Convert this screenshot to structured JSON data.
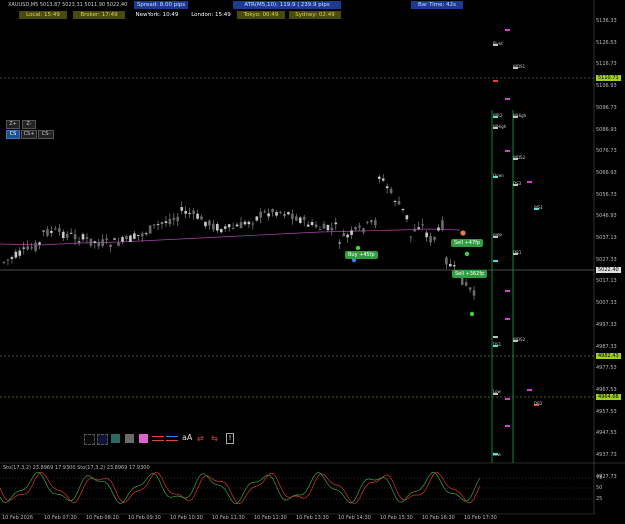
{
  "header": {
    "symbol_ohlc": "XAUUSD,M5  5013.87 5023.31 5011.90 5022.40",
    "spread": "Spread: 8.00 pips",
    "atr": "ATR(M5,10): 119.9  |  239.9 pips",
    "bar_time": "Bar Time: 42s",
    "sessions": {
      "local": "Local: 15:49",
      "broker": "Broker: 17:49",
      "newyork": "NewYork: 10:49",
      "london": "London: 15:49",
      "tokyo": "Tokyo: 00:49",
      "sydney": "Sydney: 02:49"
    }
  },
  "controls": {
    "zoom_in": "Z+",
    "zoom": "Z-",
    "cs_active": "CS",
    "cs_plus": "CS+",
    "cs_minus": "CS-"
  },
  "toolbar": {
    "font_label": "aA",
    "info_label": "!"
  },
  "price_axis": [
    "5136.33",
    "5126.53",
    "5116.73",
    "5106.93",
    "5096.73",
    "5086.93",
    "5076.73",
    "5066.93",
    "5056.73",
    "5046.93",
    "5037.13",
    "5027.33",
    "5017.13",
    "5007.33",
    "4997.33",
    "4987.33",
    "4977.53",
    "4967.53",
    "4957.53",
    "4947.53",
    "4937.73",
    "4927.73"
  ],
  "highlight_prices": {
    "upper": "5110.71",
    "current": "5022.40",
    "lower1": "4982.43",
    "lower2": "4964.66"
  },
  "time_axis": [
    "10 Feb 2026",
    "10 Feb 07:30",
    "10 Feb 08:20",
    "10 Feb 09:30",
    "10 Feb 10:30",
    "10 Feb 11:30",
    "10 Feb 12:30",
    "10 Feb 13:30",
    "10 Feb 14:30",
    "10 Feb 15:30",
    "10 Feb 16:30",
    "10 Feb 17:30"
  ],
  "trade_tags": {
    "buy": "Buy +45fp",
    "sell1": "Sell +47fp",
    "sell2": "Sell +362fp"
  },
  "level_labels": [
    "Pivot",
    "WDS1",
    "WHigh",
    "WHigh",
    "Open",
    "Low",
    "WPP",
    "DS1",
    "WDS2",
    "WS1",
    "Low",
    "DS3",
    "DR2",
    "DR1",
    "WR2",
    "WDS2"
  ],
  "oscillator": {
    "title": "Sto(17,3,2) 23.8969 17.9300  Sto(17,3,2) 23.8969 17.9300",
    "levels": [
      "75",
      "50",
      "25"
    ]
  },
  "colors": {
    "background": "#000000",
    "bull_candle": "#c8c8c8",
    "bear_candle": "#ffffff",
    "green_line": "#00cc44",
    "olive_level": "#8b9a2a",
    "magenta": "#d040d0",
    "cyan": "#40e0e0",
    "stoch_main": "#dd3333",
    "stoch_signal": "#40a040"
  }
}
